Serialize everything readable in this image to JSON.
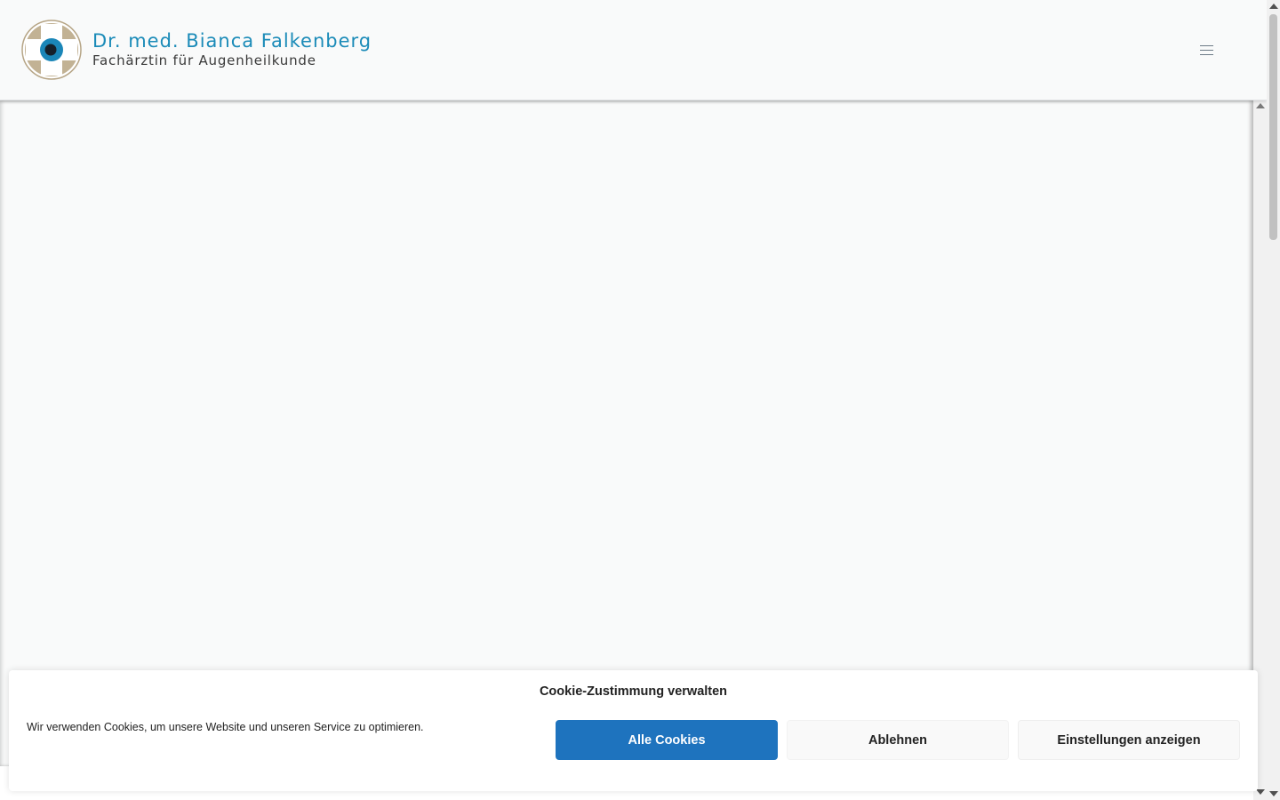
{
  "header": {
    "brand_name": "Dr. med. Bianca Falkenberg",
    "brand_tagline": "Fachärztin für Augenheilkunde",
    "logo_icon": "eye-cross-logo-icon",
    "menu_icon": "hamburger-menu-icon"
  },
  "cookie_banner": {
    "title": "Cookie-Zustimmung verwalten",
    "message": "Wir verwenden Cookies, um unsere Website und unseren Service zu optimieren.",
    "accept_label": "Alle Cookies",
    "deny_label": "Ablehnen",
    "preferences_label": "Einstellungen anzeigen"
  },
  "colors": {
    "brand_blue": "#1b8bb8",
    "accept_button": "#1e73be",
    "logo_beige": "#bfae8f",
    "background": "#f9fafa"
  }
}
